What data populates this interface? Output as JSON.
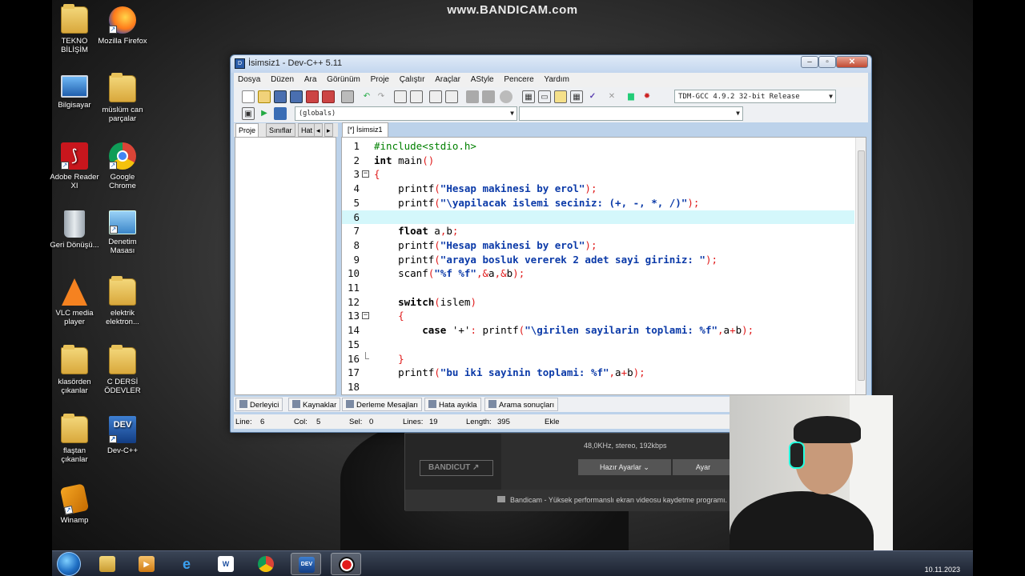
{
  "watermark": "www.BANDICAM.com",
  "desktop_icons": [
    {
      "label": "TEKNO BİLİŞİM",
      "icon": "folder-icon"
    },
    {
      "label": "Mozilla Firefox",
      "icon": "firefox-icon"
    },
    {
      "label": "Bilgisayar",
      "icon": "computer-icon"
    },
    {
      "label": "müslüm can parçalar",
      "icon": "user-folder-icon"
    },
    {
      "label": "Adobe Reader XI",
      "icon": "adobe-reader-icon"
    },
    {
      "label": "Google Chrome",
      "icon": "chrome-icon"
    },
    {
      "label": "Geri Dönüşü...",
      "icon": "recycle-bin-icon"
    },
    {
      "label": "Denetim Masası",
      "icon": "control-panel-icon"
    },
    {
      "label": "VLC media player",
      "icon": "vlc-icon"
    },
    {
      "label": "elektrik elektron...",
      "icon": "folder-icon"
    },
    {
      "label": "klasörden çıkanlar",
      "icon": "folder-icon"
    },
    {
      "label": "C DERSİ ÖDEVLER",
      "icon": "folder-icon"
    },
    {
      "label": "flaştan çıkanlar",
      "icon": "folder-icon"
    },
    {
      "label": "Dev-C++",
      "icon": "devcpp-icon"
    },
    {
      "label": "Winamp",
      "icon": "winamp-icon"
    }
  ],
  "window": {
    "title": "İsimsiz1 - Dev-C++ 5.11",
    "menu": [
      "Dosya",
      "Düzen",
      "Ara",
      "Görünüm",
      "Proje",
      "Çalıştır",
      "Araçlar",
      "AStyle",
      "Pencere",
      "Yardım"
    ],
    "compiler": "TDM-GCC 4.9.2 32-bit Release",
    "scope_combo": "(globals)",
    "left_tabs": [
      "Proje",
      "Sınıflar",
      "Hat"
    ],
    "editor_tab": "[*] İsimsiz1",
    "code_lines": [
      {
        "num": "1",
        "text": "#include<stdio.h>"
      },
      {
        "num": "2",
        "text": "int main()"
      },
      {
        "num": "3",
        "text": "{"
      },
      {
        "num": "4",
        "text": "    printf(\"Hesap makinesi by erol\");"
      },
      {
        "num": "5",
        "text": "    printf(\"\\yapilacak islemi seciniz: (+, -, *, /)\");"
      },
      {
        "num": "6",
        "text": ""
      },
      {
        "num": "7",
        "text": "    float a,b;"
      },
      {
        "num": "8",
        "text": "    printf(\"Hesap makinesi by erol\");"
      },
      {
        "num": "9",
        "text": "    printf(\"araya bosluk vererek 2 adet sayi giriniz: \");"
      },
      {
        "num": "10",
        "text": "    scanf(\"%f %f\",&a,&b);"
      },
      {
        "num": "11",
        "text": ""
      },
      {
        "num": "12",
        "text": "    switch(islem)"
      },
      {
        "num": "13",
        "text": "    {"
      },
      {
        "num": "14",
        "text": "        case '+': printf(\"\\girilen sayilarin toplami: %f\",a+b);"
      },
      {
        "num": "15",
        "text": ""
      },
      {
        "num": "16",
        "text": "    }"
      },
      {
        "num": "17",
        "text": "    printf(\"bu iki sayinin toplami: %f\",a+b);"
      },
      {
        "num": "18",
        "text": ""
      }
    ],
    "bottom_tabs": [
      "Derleyici",
      "Kaynaklar",
      "Derleme Mesajları",
      "Hata ayıkla",
      "Arama sonuçları"
    ],
    "status": {
      "line_label": "Line:",
      "line": "6",
      "col_label": "Col:",
      "col": "5",
      "sel_label": "Sel:",
      "sel": "0",
      "lines_label": "Lines:",
      "lines": "19",
      "length_label": "Length:",
      "length": "395",
      "mode": "Ekle"
    }
  },
  "bandicam": {
    "logo": "BANDICUT ↗",
    "audio_info": "48,0KHz, stereo, 192kbps",
    "presets_button": "Hazır Ayarlar",
    "settings_button": "Ayar",
    "footer": "Bandicam - Yüksek performanslı ekran videosu kaydetme programı."
  },
  "taskbar": {
    "items": [
      "start-orb",
      "explorer-icon",
      "media-player-icon",
      "ie-icon",
      "word-icon",
      "chrome-icon",
      "devcpp-icon",
      "bandicam-icon"
    ],
    "date": "10.11.2023"
  }
}
